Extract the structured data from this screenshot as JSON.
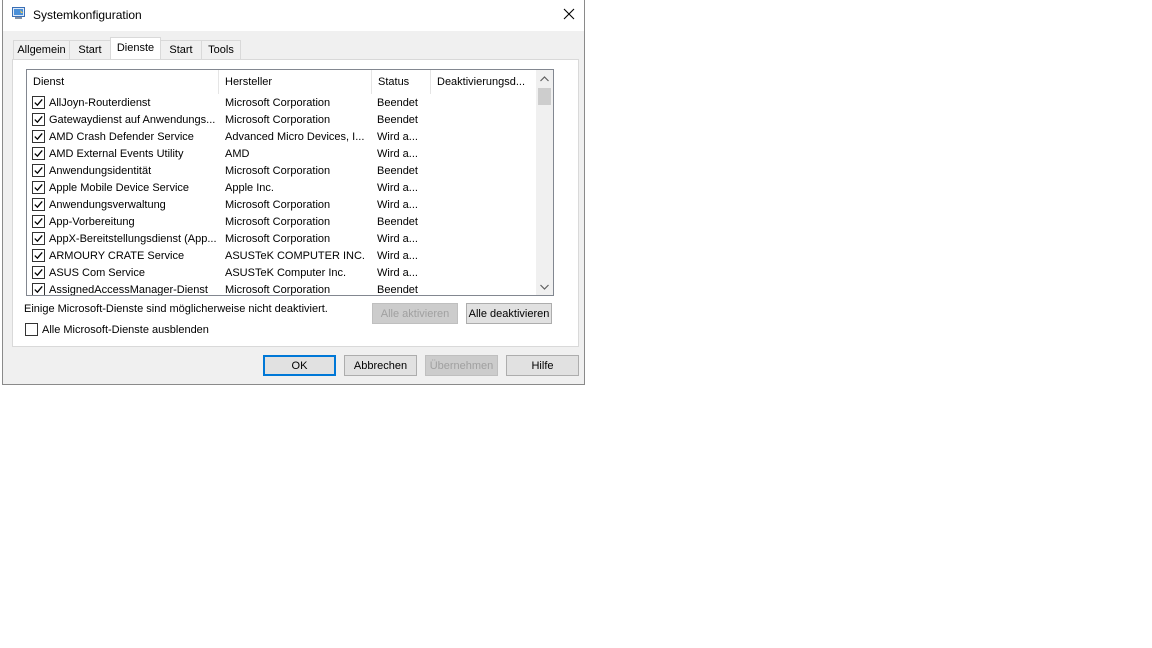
{
  "window": {
    "title": "Systemkonfiguration",
    "icon": "system-config-icon"
  },
  "tabs": [
    {
      "label": "Allgemein",
      "active": false
    },
    {
      "label": "Start",
      "active": false
    },
    {
      "label": "Dienste",
      "active": true
    },
    {
      "label": "Start",
      "active": false
    },
    {
      "label": "Tools",
      "active": false
    }
  ],
  "services": {
    "columns": [
      "Dienst",
      "Hersteller",
      "Status",
      "Deaktivierungsd..."
    ],
    "rows": [
      {
        "name": "AllJoyn-Routerdienst",
        "vendor": "Microsoft Corporation",
        "status": "Beendet",
        "checked": true
      },
      {
        "name": "Gatewaydienst auf Anwendungs...",
        "vendor": "Microsoft Corporation",
        "status": "Beendet",
        "checked": true
      },
      {
        "name": "AMD Crash Defender Service",
        "vendor": "Advanced Micro Devices, I...",
        "status": "Wird a...",
        "checked": true
      },
      {
        "name": "AMD External Events Utility",
        "vendor": "AMD",
        "status": "Wird a...",
        "checked": true
      },
      {
        "name": "Anwendungsidentität",
        "vendor": "Microsoft Corporation",
        "status": "Beendet",
        "checked": true
      },
      {
        "name": "Apple Mobile Device Service",
        "vendor": "Apple Inc.",
        "status": "Wird a...",
        "checked": true
      },
      {
        "name": "Anwendungsverwaltung",
        "vendor": "Microsoft Corporation",
        "status": "Wird a...",
        "checked": true
      },
      {
        "name": "App-Vorbereitung",
        "vendor": "Microsoft Corporation",
        "status": "Beendet",
        "checked": true
      },
      {
        "name": "AppX-Bereitstellungsdienst (App...",
        "vendor": "Microsoft Corporation",
        "status": "Wird a...",
        "checked": true
      },
      {
        "name": "ARMOURY CRATE Service",
        "vendor": "ASUSTeK COMPUTER INC.",
        "status": "Wird a...",
        "checked": true
      },
      {
        "name": "ASUS Com Service",
        "vendor": "ASUSTeK Computer Inc.",
        "status": "Wird a...",
        "checked": true
      },
      {
        "name": "AssignedAccessManager-Dienst",
        "vendor": "Microsoft Corporation",
        "status": "Beendet",
        "checked": true
      }
    ]
  },
  "note": "Einige Microsoft-Dienste sind möglicherweise nicht deaktiviert.",
  "buttons": {
    "enable_all": "Alle aktivieren",
    "disable_all": "Alle deaktivieren",
    "ok": "OK",
    "cancel": "Abbrechen",
    "apply": "Übernehmen",
    "help": "Hilfe"
  },
  "hide_ms_label": "Alle Microsoft-Dienste ausblenden",
  "hide_ms_checked": false
}
